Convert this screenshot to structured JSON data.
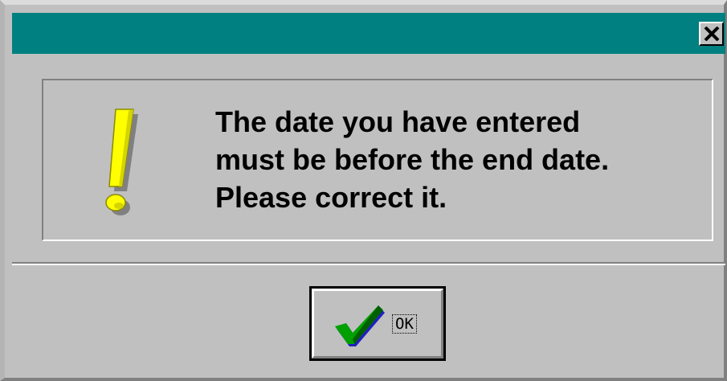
{
  "dialog": {
    "titlebar": {
      "title": "",
      "close_label": "×"
    },
    "message": {
      "text": "The date you have entered\nmust be before the end date.\nPlease correct it.",
      "icon": "exclamation-icon"
    },
    "ok_button": {
      "label": "OK",
      "icon": "checkmark-icon"
    }
  },
  "colors": {
    "titlebar": "#008080",
    "window": "#c0c0c0",
    "icon_yellow": "#ffff00",
    "check_green": "#00a000",
    "check_blue": "#2020c0"
  }
}
